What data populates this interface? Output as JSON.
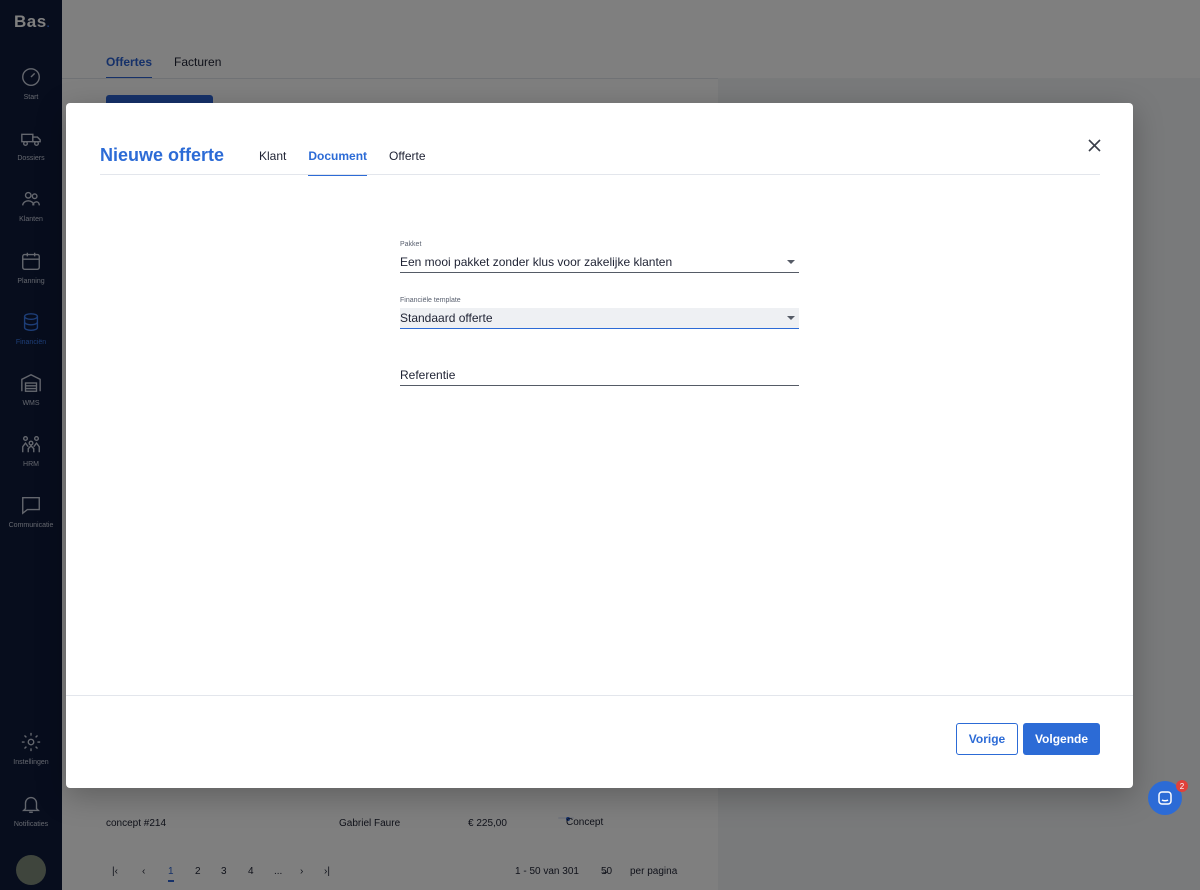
{
  "sidebar": {
    "logo": "Bas",
    "items": [
      {
        "label": "Start",
        "icon": "gauge-icon"
      },
      {
        "label": "Dossiers",
        "icon": "truck-icon"
      },
      {
        "label": "Klanten",
        "icon": "users-icon"
      },
      {
        "label": "Planning",
        "icon": "calendar-icon"
      },
      {
        "label": "Financiën",
        "icon": "coins-icon"
      },
      {
        "label": "WMS",
        "icon": "warehouse-icon"
      },
      {
        "label": "HRM",
        "icon": "team-icon"
      },
      {
        "label": "Communicatie",
        "icon": "chat-icon"
      },
      {
        "label": "Instellingen",
        "icon": "gear-icon"
      },
      {
        "label": "Notificaties",
        "icon": "bell-icon"
      }
    ]
  },
  "background": {
    "tabs": [
      "Offertes",
      "Facturen"
    ],
    "row": {
      "name": "concept #214",
      "customer": "Gabriel Faure",
      "amount": "€ 225,00",
      "status": "Concept"
    },
    "pager": {
      "pages": [
        "1",
        "2",
        "3",
        "4",
        "..."
      ],
      "range": "1 - 50 van 301",
      "per_page_value": "50",
      "per_page_label": "per pagina"
    }
  },
  "modal": {
    "title": "Nieuwe offerte",
    "tabs": [
      "Klant",
      "Document",
      "Offerte"
    ],
    "active_tab": "Document",
    "fields": {
      "pakket": {
        "label": "Pakket",
        "value": "Een mooi pakket zonder klus voor zakelijke klanten"
      },
      "template": {
        "label": "Financiële template",
        "value": "Standaard offerte"
      },
      "referentie": {
        "placeholder": "Referentie"
      }
    },
    "buttons": {
      "prev": "Vorige",
      "next": "Volgende"
    }
  },
  "chat": {
    "badge": "2"
  },
  "colors": {
    "accent": "#2c6bd6",
    "sidebar": "#0f1a3a",
    "badge": "#e0413a"
  }
}
